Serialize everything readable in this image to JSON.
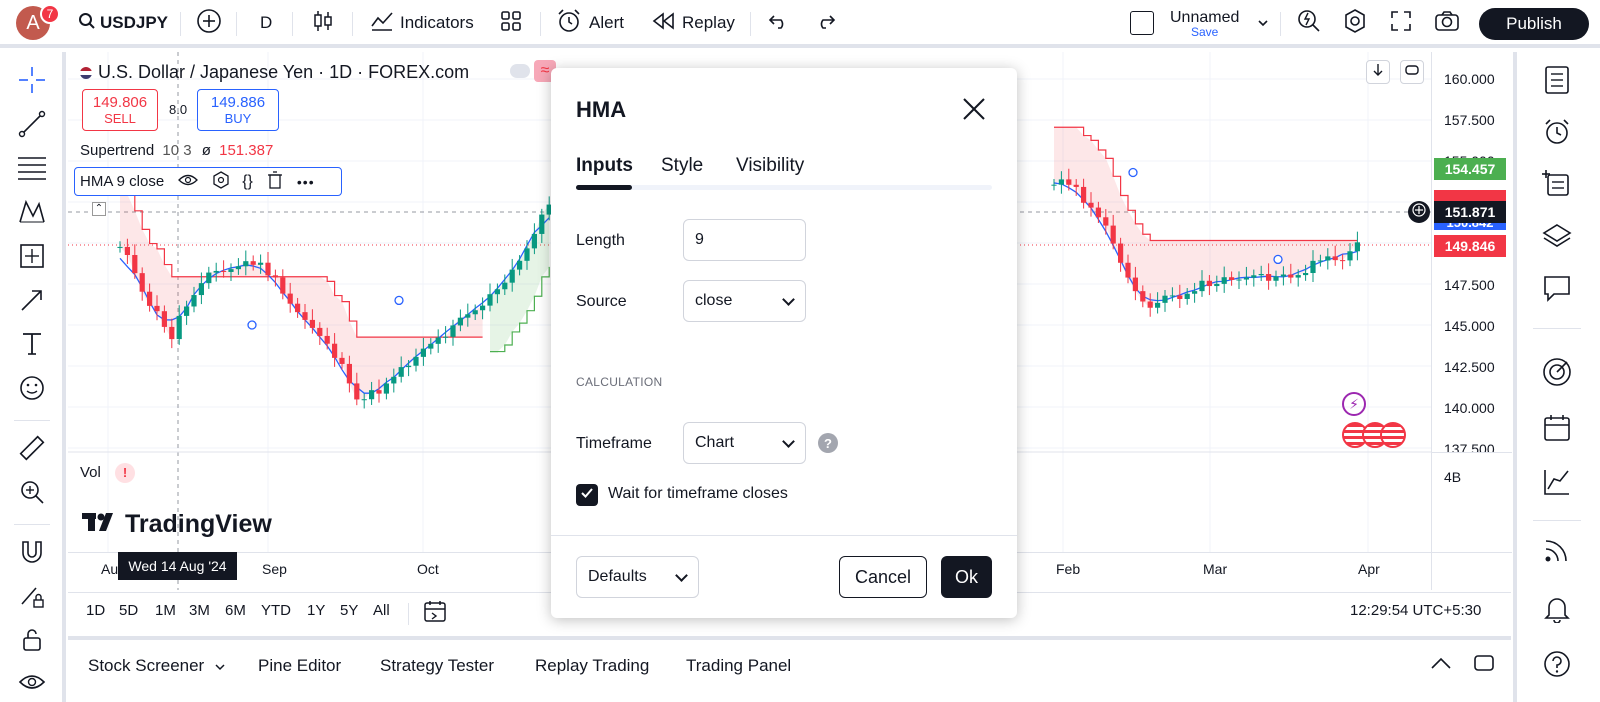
{
  "topbar": {
    "avatar_letter": "A",
    "notification_count": "7",
    "symbol": "USDJPY",
    "interval": "D",
    "indicators_label": "Indicators",
    "alert_label": "Alert",
    "replay_label": "Replay",
    "layout_name": "Unnamed",
    "save_label": "Save",
    "publish_label": "Publish"
  },
  "chart": {
    "symbol_title": "U.S. Dollar / Japanese Yen · 1D · FOREX.com",
    "sell_price": "149.806",
    "sell_label": "SELL",
    "spread": "8.0",
    "buy_price": "149.886",
    "buy_label": "BUY",
    "supertrend_name": "Supertrend",
    "supertrend_params": "10 3",
    "supertrend_symbol": "ø",
    "supertrend_value": "151.387",
    "hma_legend": "HMA 9 close",
    "vol_label": "Vol",
    "vol_warning": "!",
    "logo_text": "TradingView",
    "crosshair_date": "Wed 14 Aug '24",
    "time_labels": [
      "Aug",
      "Sep",
      "Oct",
      "Feb",
      "Mar",
      "Apr"
    ],
    "price_labels": [
      "160.000",
      "157.500",
      "155.000",
      "152.500",
      "150.000",
      "147.500",
      "145.000",
      "142.500",
      "140.000",
      "137.500"
    ],
    "price_tag_green": "154.457",
    "price_tag_crosshair": "151.871",
    "price_tag_blue": "150.842",
    "price_tag_red": "149.846",
    "volume_scale": "4B",
    "colors": {
      "up": "#089981",
      "down": "#f23645",
      "hma": "#2962ff",
      "supertrend_down": "#f23645",
      "supertrend_up": "#4caf50"
    }
  },
  "chart_data": {
    "type": "candlestick",
    "title": "U.S. Dollar / Japanese Yen · 1D · FOREX.com",
    "y_range": [
      137.5,
      160.0
    ],
    "series": [
      {
        "name": "Supertrend"
      },
      {
        "name": "HMA 9 close"
      }
    ]
  },
  "range_bar": {
    "ranges": [
      "1D",
      "5D",
      "1M",
      "3M",
      "6M",
      "YTD",
      "1Y",
      "5Y",
      "All"
    ],
    "clock": "12:29:54 UTC+5:30"
  },
  "bottom_panel": {
    "tabs": [
      "Stock Screener",
      "Pine Editor",
      "Strategy Tester",
      "Replay Trading",
      "Trading Panel"
    ]
  },
  "dialog": {
    "title": "HMA",
    "tabs": [
      "Inputs",
      "Style",
      "Visibility"
    ],
    "length_label": "Length",
    "length_value": "9",
    "source_label": "Source",
    "source_value": "close",
    "calculation_heading": "CALCULATION",
    "timeframe_label": "Timeframe",
    "timeframe_value": "Chart",
    "help_glyph": "?",
    "wait_label": "Wait for timeframe closes",
    "wait_checked": true,
    "defaults_label": "Defaults",
    "cancel_label": "Cancel",
    "ok_label": "Ok"
  }
}
